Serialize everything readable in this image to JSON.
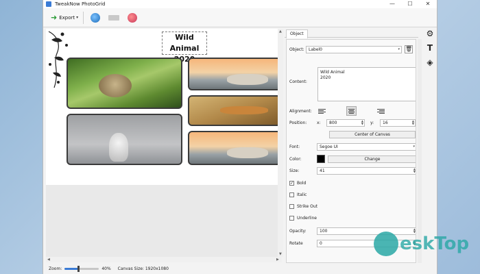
{
  "window": {
    "title": "TweakNow PhotoGrid",
    "controls": [
      "—",
      "☐",
      "✕"
    ]
  },
  "toolbar": {
    "export_label": "Export"
  },
  "canvas": {
    "label_text_line1": "Wild Animal",
    "label_text_line2": "2020"
  },
  "status": {
    "zoom_label": "Zoom:",
    "zoom_value": "40%",
    "canvas_size": "Canvas Size: 1920x1080",
    "zoom_fraction": 0.4
  },
  "panel": {
    "tab": "Object",
    "object_label": "Object:",
    "object_value": "Label0",
    "content_label": "Content:",
    "content_value": "Wild Animal\n2020",
    "alignment_label": "Alignment:",
    "position_label": "Position:",
    "x_label": "x:",
    "x_value": "800",
    "y_label": "y:",
    "y_value": "16",
    "center_button": "Center of Canvas",
    "font_label": "Font:",
    "font_value": "Segoe UI",
    "color_label": "Color:",
    "color_value": "#000000",
    "change_button": "Change",
    "size_label": "Size:",
    "size_value": "41",
    "bold_label": "Bold",
    "bold_checked": true,
    "italic_label": "Italic",
    "strikeout_label": "Strike Out",
    "underline_label": "Underline",
    "opacity_label": "Opacity:",
    "opacity_value": "100",
    "rotate_label": "Rotate",
    "rotate_value": "0"
  },
  "side_icons": [
    "gear-icon",
    "text-icon",
    "layers-icon"
  ],
  "watermark": {
    "text": "eskTop"
  },
  "colors": {
    "accent": "#3a7bd5",
    "export_arrow": "#2e9d3a",
    "watermark": "#2aa8a6"
  }
}
